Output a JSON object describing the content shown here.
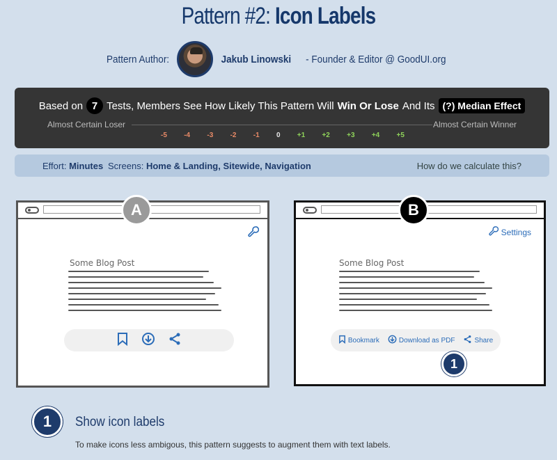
{
  "header": {
    "title_prefix": "Pattern #2:",
    "title_strong": "Icon Labels"
  },
  "author": {
    "label": "Pattern Author:",
    "name": "Jakub Linowski",
    "role": "- Founder & Editor @ GoodUI.org"
  },
  "effect": {
    "text_before": "Based on",
    "tests": "7",
    "text_middle": "Tests, Members See How Likely This Pattern Will",
    "win_lose": "Win Or Lose",
    "text_after": "And Its",
    "median_badge": "(?) Median Effect",
    "left_label": "Almost Certain Loser",
    "right_label": "Almost Certain Winner",
    "ticks": [
      "-5",
      "-4",
      "-3",
      "-2",
      "-1",
      "0",
      "+1",
      "+2",
      "+3",
      "+4",
      "+5"
    ]
  },
  "meta": {
    "effort_label": "Effort:",
    "effort_value": "Minutes",
    "screens_label": "Screens:",
    "screens_value": "Home & Landing, Sitewide, Navigation",
    "how_link": "How do we calculate this?"
  },
  "variant_a": {
    "badge": "A",
    "post_title": "Some Blog Post",
    "icons": [
      "bookmark-icon",
      "download-icon",
      "share-icon"
    ]
  },
  "variant_b": {
    "badge": "B",
    "settings_label": "Settings",
    "post_title": "Some Blog Post",
    "actions": [
      {
        "icon": "bookmark-icon",
        "label": "Bookmark"
      },
      {
        "icon": "download-icon",
        "label": "Download as PDF"
      },
      {
        "icon": "share-icon",
        "label": "Share"
      }
    ],
    "callout": "1"
  },
  "step": {
    "number": "1",
    "title": "Show icon labels",
    "description": "To make icons less ambigous, this pattern suggests to augment them with text labels."
  },
  "colors": {
    "background": "#d3dfec",
    "navy": "#1e3b6b",
    "icon_blue": "#2b6cb8",
    "dark_panel": "#353535",
    "negative": "#e88a67",
    "positive": "#8fd35a"
  }
}
